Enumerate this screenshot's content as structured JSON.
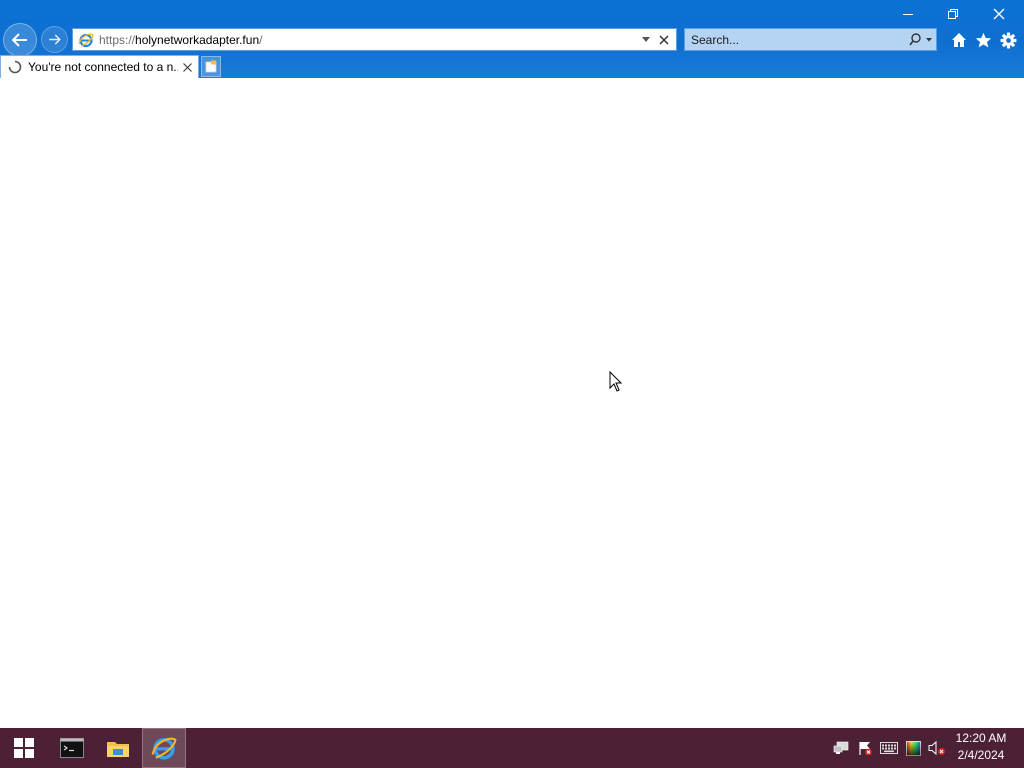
{
  "browser": {
    "address_bar": {
      "url_scheme": "https://",
      "url_host": "holynetworkadapter.fun",
      "url_path": "/"
    },
    "search": {
      "placeholder": "Search..."
    },
    "tabs": [
      {
        "title": "You're not connected to a n...",
        "loading": true
      }
    ],
    "icons": {
      "back": "back-arrow-icon",
      "forward": "forward-arrow-icon",
      "home": "home-icon",
      "favorites": "star-icon",
      "tools": "gear-icon"
    },
    "colors": {
      "chrome": "#0f6fd0",
      "search_bg": "#b5d3f3"
    }
  },
  "taskbar": {
    "pinned": [
      {
        "name": "command-prompt"
      },
      {
        "name": "file-explorer"
      },
      {
        "name": "internet-explorer",
        "active": true
      }
    ],
    "tray": [
      "network-icon",
      "flag-icon",
      "keyboard-icon",
      "color-icon",
      "volume-muted-icon"
    ],
    "clock": {
      "time": "12:20 AM",
      "date": "2/4/2024"
    },
    "colors": {
      "background": "#4d2135"
    }
  }
}
